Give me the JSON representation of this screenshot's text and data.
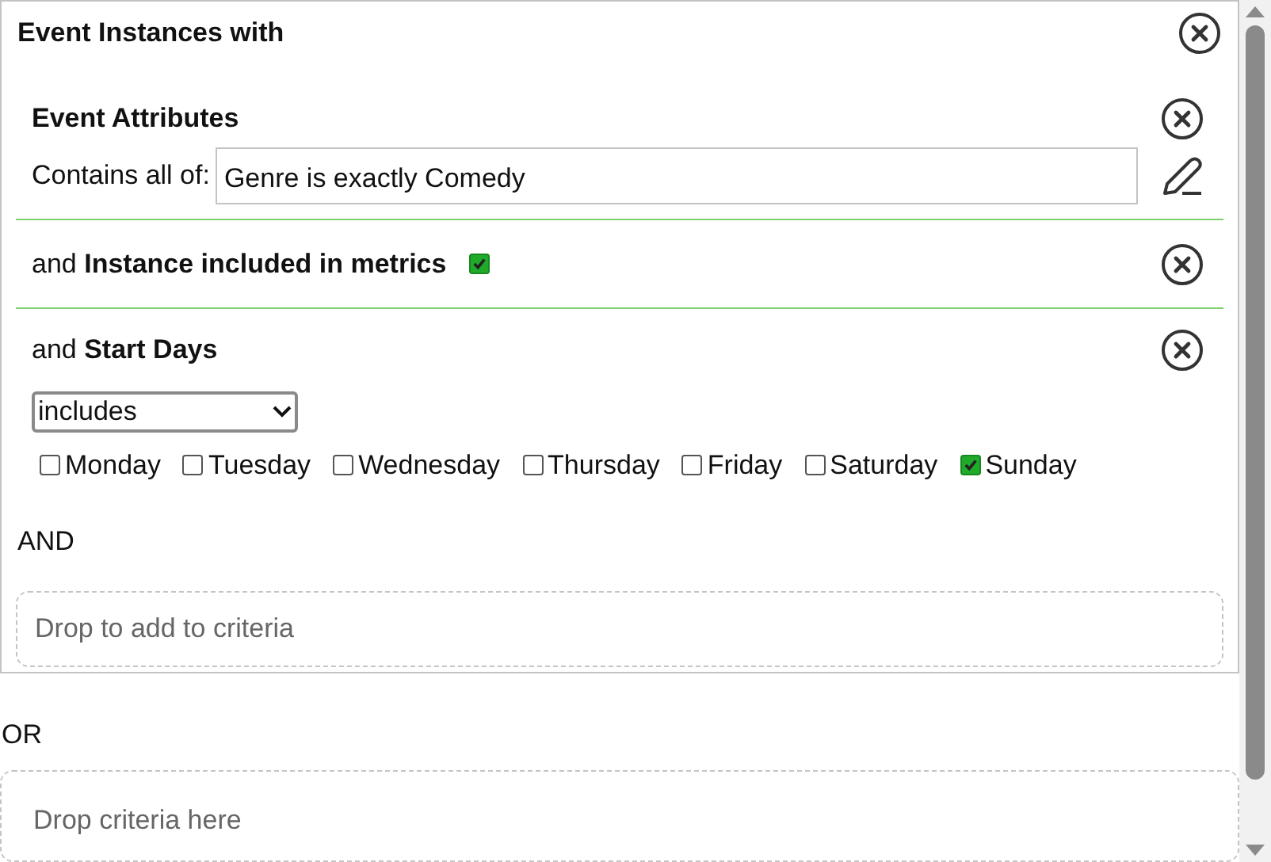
{
  "group": {
    "title": "Event Instances with",
    "criteria": [
      {
        "kind": "attributes",
        "title": "Event Attributes",
        "label": "Contains all of:",
        "value": "Genre is exactly Comedy"
      },
      {
        "kind": "toggle",
        "prefix": "and",
        "title": "Instance included in metrics",
        "checked": true
      },
      {
        "kind": "days",
        "prefix": "and",
        "title": "Start Days",
        "select": "includes",
        "days": [
          {
            "label": "Monday",
            "checked": false
          },
          {
            "label": "Tuesday",
            "checked": false
          },
          {
            "label": "Wednesday",
            "checked": false
          },
          {
            "label": "Thursday",
            "checked": false
          },
          {
            "label": "Friday",
            "checked": false
          },
          {
            "label": "Saturday",
            "checked": false
          },
          {
            "label": "Sunday",
            "checked": true
          }
        ]
      }
    ],
    "joiner": "AND",
    "drop_zone": "Drop to add to criteria"
  },
  "or_label": "OR",
  "drop_zone": "Drop criteria here"
}
